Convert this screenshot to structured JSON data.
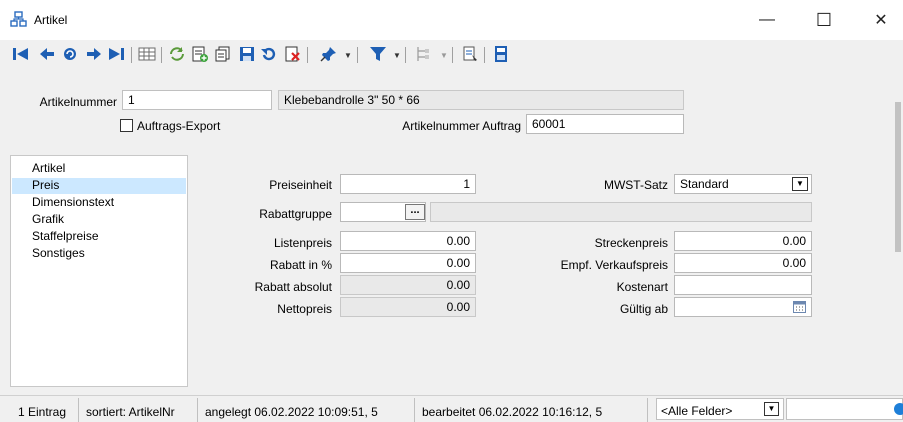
{
  "window": {
    "title": "Artikel",
    "controls": {
      "minimize": "—",
      "maximize": "☐",
      "close": "✕"
    }
  },
  "toolbar": {
    "icons": [
      "first-record",
      "previous-record",
      "refresh-record",
      "next-record",
      "last-record",
      "table-view",
      "reload",
      "new-record",
      "copy-record",
      "save-record",
      "undo",
      "delete-record",
      "pin",
      "filter",
      "tree",
      "report",
      "calculator"
    ]
  },
  "header": {
    "artikelnummer_label": "Artikelnummer",
    "artikelnummer_value": "1",
    "bezeichnung_value": "Klebebandrolle 3\" 50 * 66",
    "auftrags_export_label": "Auftrags-Export",
    "auftrags_export_checked": false,
    "artikelnummer_auftrag_label": "Artikelnummer Auftrag",
    "artikelnummer_auftrag_value": "60001"
  },
  "nav": {
    "items": [
      {
        "label": "Artikel",
        "selected": false
      },
      {
        "label": "Preis",
        "selected": true
      },
      {
        "label": "Dimensionstext",
        "selected": false
      },
      {
        "label": "Grafik",
        "selected": false
      },
      {
        "label": "Staffelpreise",
        "selected": false
      },
      {
        "label": "Sonstiges",
        "selected": false
      }
    ]
  },
  "preis": {
    "preiseinheit_label": "Preiseinheit",
    "preiseinheit_value": "1",
    "rabattgruppe_label": "Rabattgruppe",
    "rabattgruppe_button": "...",
    "listenpreis_label": "Listenpreis",
    "listenpreis_value": "0.00",
    "rabatt_prozent_label": "Rabatt in %",
    "rabatt_prozent_value": "0.00",
    "rabatt_absolut_label": "Rabatt absolut",
    "rabatt_absolut_value": "0.00",
    "nettopreis_label": "Nettopreis",
    "nettopreis_value": "0.00",
    "mwst_label": "MWST-Satz",
    "mwst_value": "Standard",
    "streckenpreis_label": "Streckenpreis",
    "streckenpreis_value": "0.00",
    "empf_vk_label": "Empf. Verkaufspreis",
    "empf_vk_value": "0.00",
    "kostenart_label": "Kostenart",
    "kostenart_value": "",
    "gueltig_ab_label": "Gültig ab",
    "gueltig_ab_value": ""
  },
  "status": {
    "count": "1 Eintrag",
    "sort": "sortiert: ArtikelNr",
    "created": "angelegt 06.02.2022 10:09:51, 5",
    "edited": "bearbeitet 06.02.2022 10:16:12, 5",
    "field_filter": "<Alle Felder>",
    "search_value": ""
  }
}
